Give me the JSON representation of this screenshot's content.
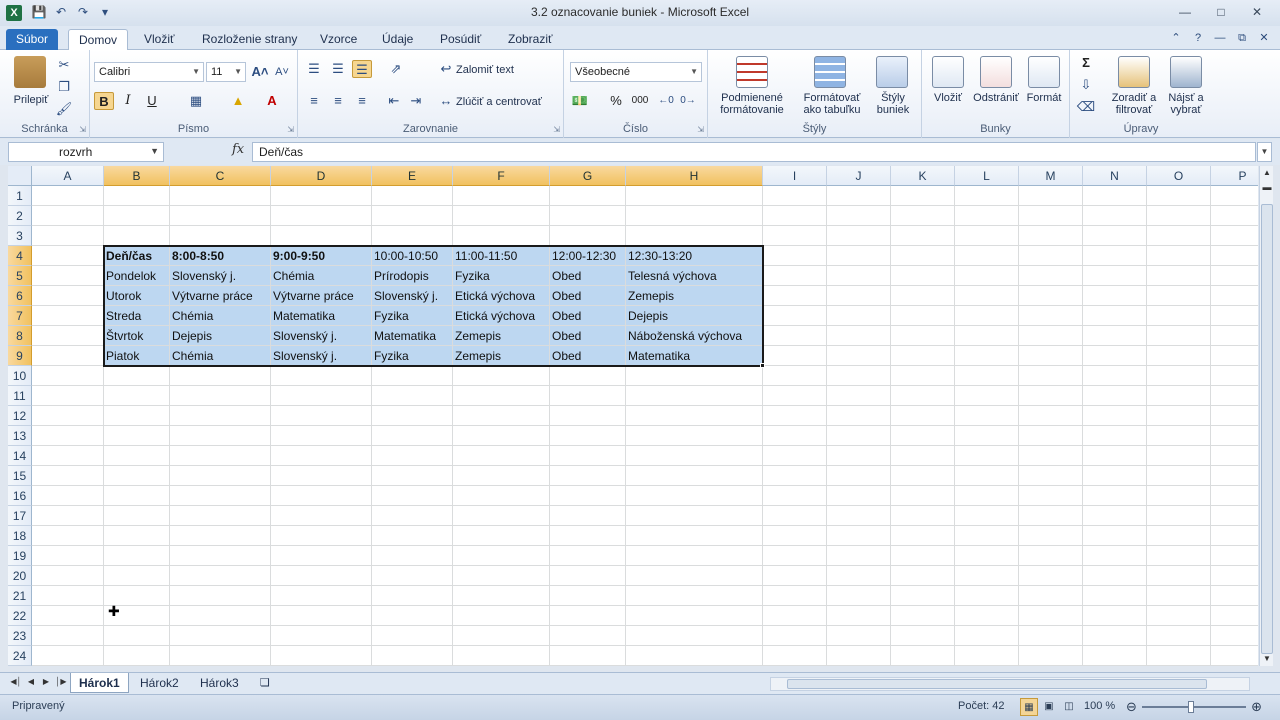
{
  "window": {
    "title": "3.2 oznacovanie buniek  -  Microsoft Excel",
    "app_icon": "X"
  },
  "ribbon_tabs": [
    "Súbor",
    "Domov",
    "Vložiť",
    "Rozloženie strany",
    "Vzorce",
    "Údaje",
    "Posúdiť",
    "Zobraziť"
  ],
  "active_tab": "Domov",
  "ribbon": {
    "clipboard": {
      "label": "Schránka",
      "paste": "Prilepiť"
    },
    "font": {
      "label": "Písmo",
      "name": "Calibri",
      "size": "11",
      "bold": "B",
      "italic": "I",
      "underline": "U"
    },
    "alignment": {
      "label": "Zarovnanie",
      "wrap": "Zalomiť text",
      "merge": "Zlúčiť a centrovať"
    },
    "number": {
      "label": "Číslo",
      "format": "Všeobecné",
      "percent": "%",
      "thousands": "000"
    },
    "styles": {
      "label": "Štýly",
      "conditional_1": "Podmienené",
      "conditional_2": "formátovanie",
      "table_1": "Formátovať",
      "table_2": "ako tabuľku",
      "cell_1": "Štýly",
      "cell_2": "buniek"
    },
    "cells": {
      "label": "Bunky",
      "insert": "Vložiť",
      "delete": "Odstrániť",
      "format": "Formát"
    },
    "editing": {
      "label": "Úpravy",
      "sort_1": "Zoradiť a",
      "sort_2": "filtrovať",
      "find_1": "Nájsť a",
      "find_2": "vybrať"
    }
  },
  "formula_bar": {
    "name_box": "rozvrh",
    "fx": "fx",
    "value": "Deň/čas"
  },
  "columns": [
    "A",
    "B",
    "C",
    "D",
    "E",
    "F",
    "G",
    "H",
    "I",
    "J",
    "K",
    "L",
    "M",
    "N",
    "O",
    "P"
  ],
  "rows": [
    "1",
    "2",
    "3",
    "4",
    "5",
    "6",
    "7",
    "8",
    "9",
    "10",
    "11",
    "12",
    "13",
    "14",
    "15",
    "16",
    "17",
    "18",
    "19",
    "20",
    "21",
    "22",
    "23",
    "24"
  ],
  "table": {
    "header": [
      "Deň/čas",
      "8:00-8:50",
      "9:00-9:50",
      "10:00-10:50",
      "11:00-11:50",
      "12:00-12:30",
      "12:30-13:20"
    ],
    "body": [
      [
        "Pondelok",
        "Slovenský j.",
        "Chémia",
        "Prírodopis",
        "Fyzika",
        "Obed",
        "Telesná výchova"
      ],
      [
        "Utorok",
        "Výtvarne práce",
        "Výtvarne práce",
        "Slovenský j.",
        "Etická výchova",
        "Obed",
        "Zemepis"
      ],
      [
        "Streda",
        "Chémia",
        "Matematika",
        "Fyzika",
        "Etická výchova",
        "Obed",
        "Dejepis"
      ],
      [
        "Štvrtok",
        "Dejepis",
        "Slovenský j.",
        "Matematika",
        "Zemepis",
        "Obed",
        "Náboženská výchova"
      ],
      [
        "Piatok",
        "Chémia",
        "Slovenský j.",
        "Fyzika",
        "Zemepis",
        "Obed",
        "Matematika"
      ]
    ]
  },
  "sheets": [
    "Hárok1",
    "Hárok2",
    "Hárok3"
  ],
  "active_sheet": "Hárok1",
  "status": {
    "mode": "Pripravený",
    "count": "Počet: 42",
    "zoom": "100 %"
  }
}
